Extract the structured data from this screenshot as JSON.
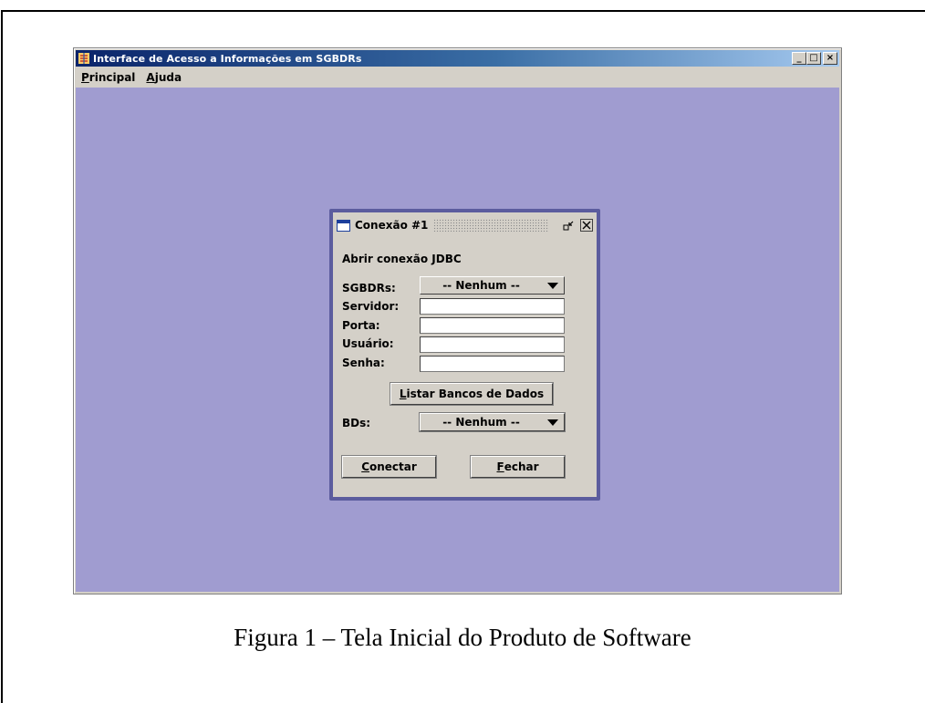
{
  "window": {
    "title": "Interface de Acesso a Informações em SGBDRs",
    "controls": {
      "minimize": "_",
      "maximize": "□",
      "close": "×"
    }
  },
  "menu": {
    "items": [
      {
        "mnemonic": "P",
        "rest": "rincipal"
      },
      {
        "mnemonic": "A",
        "rest": "juda"
      }
    ]
  },
  "dialog": {
    "title": "Conexão #1",
    "heading": "Abrir conexão JDBC",
    "labels": {
      "sgbdrs": "SGBDRs:",
      "servidor": "Servidor:",
      "porta": "Porta:",
      "usuario": "Usuário:",
      "senha": "Senha:",
      "bds": "BDs:"
    },
    "sgbdrs_selected": "-- Nenhum --",
    "bds_selected": "-- Nenhum --",
    "fields": {
      "servidor": "",
      "porta": "",
      "usuario": "",
      "senha": ""
    },
    "buttons": {
      "listar": {
        "mnemonic": "L",
        "rest": "istar Bancos de Dados"
      },
      "conectar": {
        "mnemonic": "C",
        "rest": "onectar"
      },
      "fechar": {
        "mnemonic": "F",
        "rest": "echar"
      }
    }
  },
  "caption": "Figura 1 – Tela Inicial do Produto de Software",
  "colors": {
    "desktop": "#a09cd0",
    "frame_border": "#5b5c9e",
    "title_bar": "#0a246a",
    "panel": "#d4d0c8"
  }
}
